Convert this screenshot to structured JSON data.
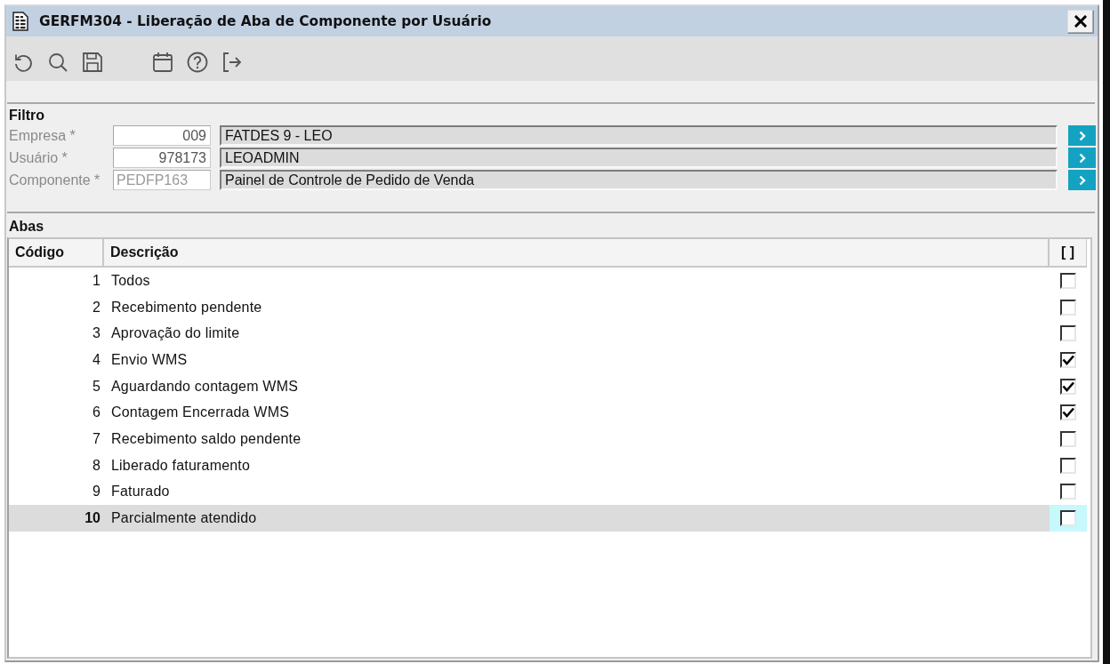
{
  "window": {
    "title": "GERFM304 - Liberação de Aba de Componente por Usuário"
  },
  "filter": {
    "title": "Filtro",
    "fields": [
      {
        "label": "Empresa *",
        "code": "009",
        "description": "FATDES 9 - LEO",
        "disabled": false
      },
      {
        "label": "Usuário *",
        "code": "978173",
        "description": "LEOADMIN",
        "disabled": false
      },
      {
        "label": "Componente *",
        "code": "PEDFP163",
        "description": "Painel de Controle de Pedido de Venda",
        "disabled": true
      }
    ]
  },
  "tabs": {
    "title": "Abas",
    "table": {
      "columns": [
        "Código",
        "Descrição",
        "[ ]"
      ],
      "rows": [
        {
          "code": "1",
          "description": "Todos",
          "checked": false,
          "selected": false
        },
        {
          "code": "2",
          "description": "Recebimento pendente",
          "checked": false,
          "selected": false
        },
        {
          "code": "3",
          "description": "Aprovação do limite",
          "checked": false,
          "selected": false
        },
        {
          "code": "4",
          "description": "Envio WMS",
          "checked": true,
          "selected": false
        },
        {
          "code": "5",
          "description": "Aguardando contagem WMS",
          "checked": true,
          "selected": false
        },
        {
          "code": "6",
          "description": "Contagem Encerrada WMS",
          "checked": true,
          "selected": false
        },
        {
          "code": "7",
          "description": "Recebimento saldo pendente",
          "checked": false,
          "selected": false
        },
        {
          "code": "8",
          "description": "Liberado faturamento",
          "checked": false,
          "selected": false
        },
        {
          "code": "9",
          "description": "Faturado",
          "checked": false,
          "selected": false
        },
        {
          "code": "10",
          "description": "Parcialmente atendido",
          "checked": false,
          "selected": true
        }
      ]
    }
  }
}
